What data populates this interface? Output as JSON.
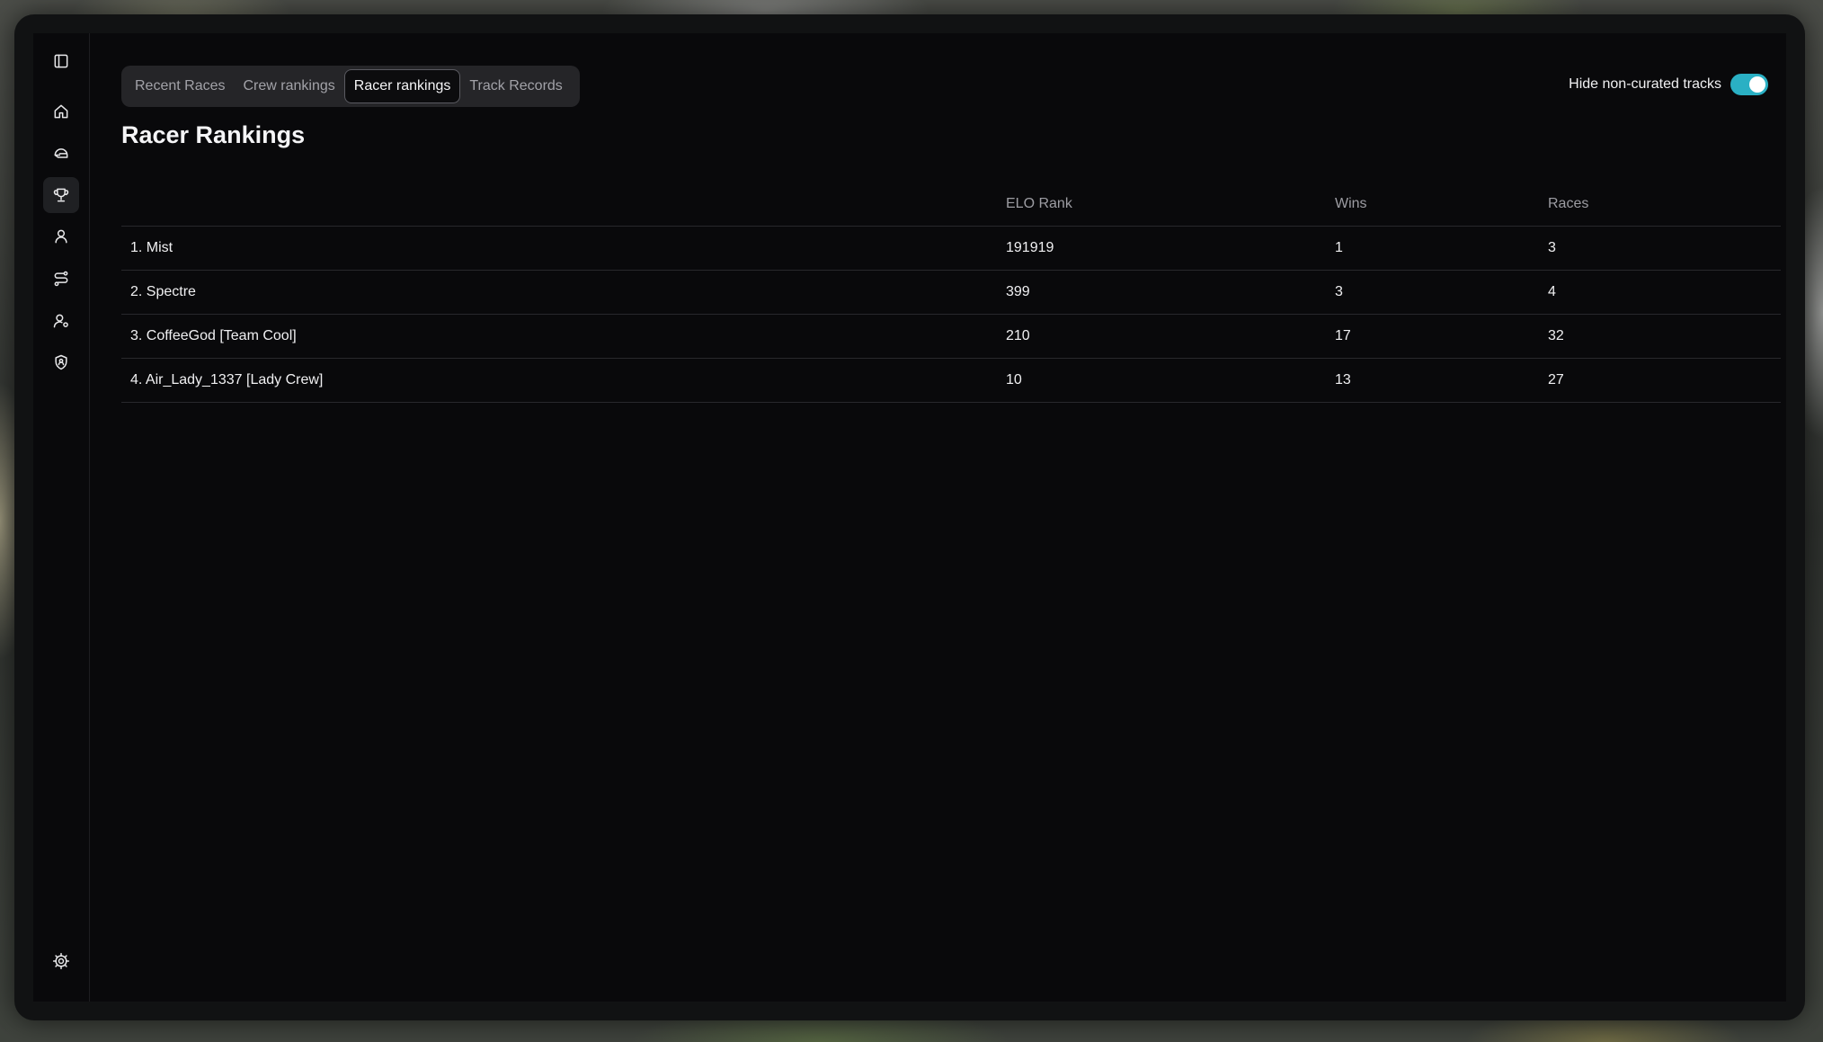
{
  "tabs": [
    {
      "label": "Recent Races",
      "active": false
    },
    {
      "label": "Crew rankings",
      "active": false
    },
    {
      "label": "Racer rankings",
      "active": true
    },
    {
      "label": "Track Records",
      "active": false
    }
  ],
  "toggle": {
    "label": "Hide non-curated tracks",
    "on": true,
    "color": "#2ab0c4"
  },
  "page_title": "Racer Rankings",
  "table": {
    "columns": [
      "",
      "ELO Rank",
      "Wins",
      "Races"
    ],
    "rows": [
      {
        "name": "1. Mist",
        "elo": "191919",
        "wins": "1",
        "races": "3"
      },
      {
        "name": "2. Spectre",
        "elo": "399",
        "wins": "3",
        "races": "4"
      },
      {
        "name": "3. CoffeeGod [Team Cool]",
        "elo": "210",
        "wins": "17",
        "races": "32"
      },
      {
        "name": "4. Air_Lady_1337 [Lady Crew]",
        "elo": "10",
        "wins": "13",
        "races": "27"
      }
    ]
  },
  "sidebar": {
    "items": [
      {
        "icon": "sidebar-toggle-icon"
      },
      {
        "icon": "home-icon"
      },
      {
        "icon": "helmet-icon"
      },
      {
        "icon": "trophy-icon",
        "active": true
      },
      {
        "icon": "user-icon"
      },
      {
        "icon": "route-icon"
      },
      {
        "icon": "user-settings-icon"
      },
      {
        "icon": "shield-icon"
      },
      {
        "icon": "gear-icon"
      }
    ]
  }
}
